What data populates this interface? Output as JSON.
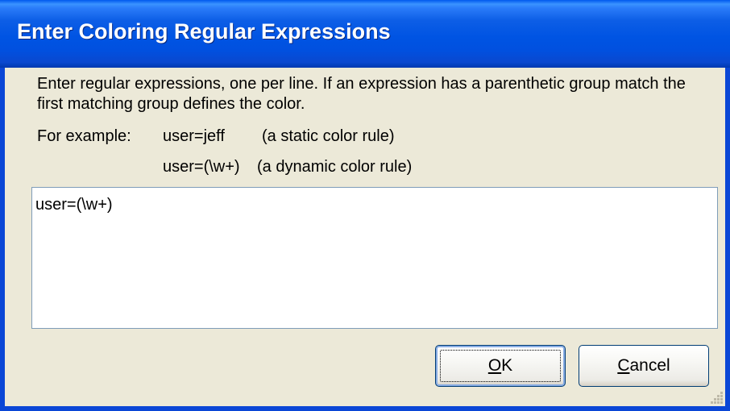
{
  "window": {
    "title": "Enter Coloring Regular Expressions"
  },
  "instructions": "Enter regular expressions, one per line. If an expression has a parenthetic group match the first matching group defines the color.",
  "example": {
    "label": "For example:",
    "rows": [
      {
        "code": "user=jeff",
        "desc": "(a static color rule)"
      },
      {
        "code": "user=(\\w+)",
        "desc": "(a dynamic color rule)"
      }
    ]
  },
  "expressions": {
    "value": "user=(\\w+)"
  },
  "buttons": {
    "ok": {
      "accel": "O",
      "rest": "K"
    },
    "cancel": {
      "accel": "C",
      "rest": "ancel"
    }
  },
  "colors": {
    "titlebar": "#0054e3",
    "face": "#ece9d8",
    "border": "#003c74"
  }
}
